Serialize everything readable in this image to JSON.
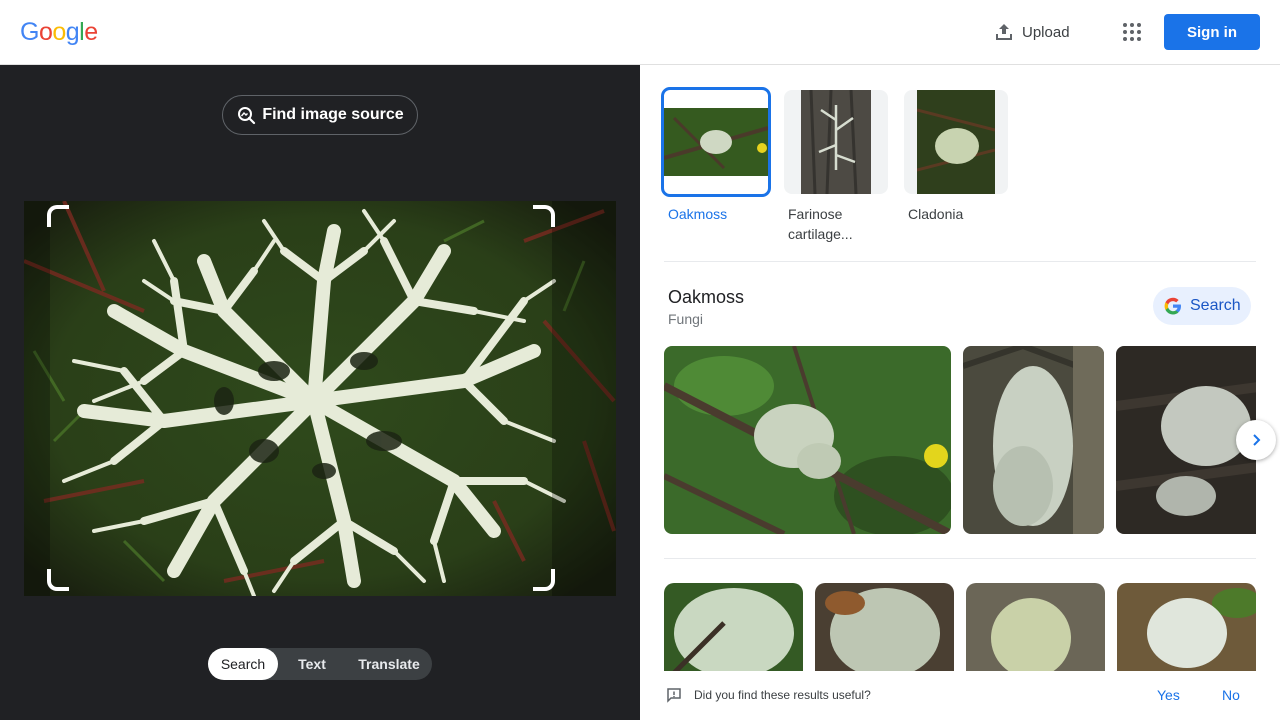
{
  "header": {
    "logo_letters": [
      "G",
      "o",
      "o",
      "g",
      "l",
      "e"
    ],
    "logo_colors": [
      "#4285F4",
      "#EA4335",
      "#FBBC05",
      "#4285F4",
      "#34A853",
      "#EA4335"
    ],
    "upload_label": "Upload",
    "apps_icon": "apps-grid-icon",
    "signin_label": "Sign in"
  },
  "lens": {
    "find_source_label": "Find image source",
    "modes": [
      {
        "label": "Search",
        "active": true
      },
      {
        "label": "Text",
        "active": false
      },
      {
        "label": "Translate",
        "active": false
      }
    ]
  },
  "results": {
    "chips": [
      {
        "label": "Oakmoss",
        "selected": true
      },
      {
        "label": "Farinose cartilage...",
        "selected": false
      },
      {
        "label": "Cladonia",
        "selected": false
      }
    ],
    "entity": {
      "title": "Oakmoss",
      "subtitle": "Fungi",
      "search_label": "Search"
    },
    "feedback": {
      "question": "Did you find these results useful?",
      "yes": "Yes",
      "no": "No"
    }
  },
  "colors": {
    "accent": "#1a73e8",
    "dark_panel": "#202124",
    "lichen": "#e4ead5",
    "moss": "#3f6a22"
  }
}
